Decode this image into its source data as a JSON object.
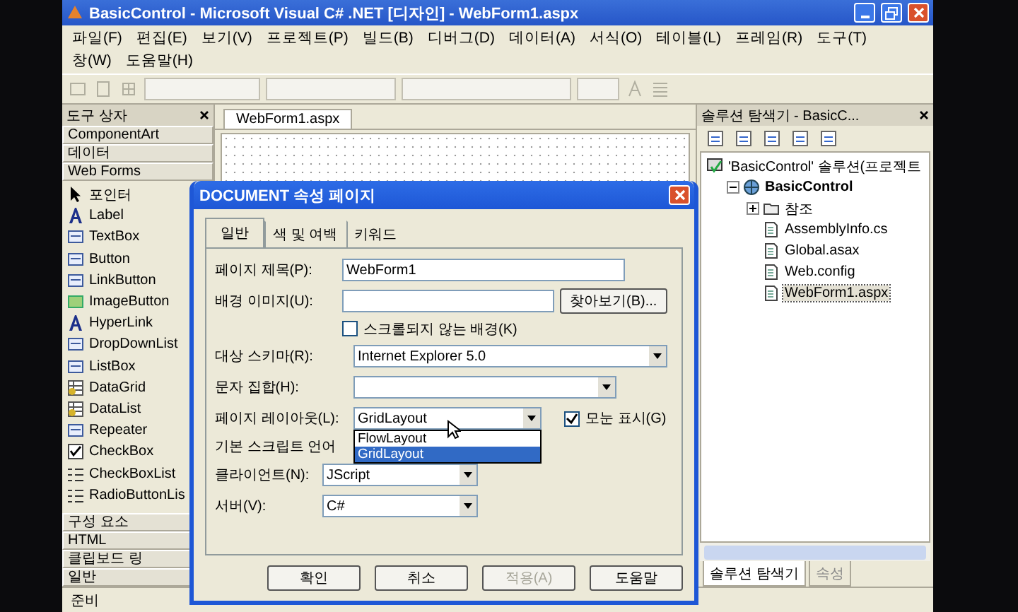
{
  "window": {
    "title": "BasicControl - Microsoft Visual C# .NET [디자인] - WebForm1.aspx"
  },
  "menu": [
    "파일(F)",
    "편집(E)",
    "보기(V)",
    "프로젝트(P)",
    "빌드(B)",
    "디버그(D)",
    "데이터(A)",
    "서식(O)",
    "테이블(L)",
    "프레임(R)",
    "도구(T)",
    "창(W)",
    "도움말(H)"
  ],
  "toolbox": {
    "title": "도구 상자",
    "top_groups": [
      "ComponentArt",
      "데이터",
      "Web Forms"
    ],
    "items": [
      {
        "label": "포인터",
        "kind": "pointer"
      },
      {
        "label": "Label",
        "kind": "letter"
      },
      {
        "label": "TextBox",
        "kind": "control"
      },
      {
        "label": "Button",
        "kind": "control"
      },
      {
        "label": "LinkButton",
        "kind": "control"
      },
      {
        "label": "ImageButton",
        "kind": "image"
      },
      {
        "label": "HyperLink",
        "kind": "letter"
      },
      {
        "label": "DropDownList",
        "kind": "control"
      },
      {
        "label": "ListBox",
        "kind": "control"
      },
      {
        "label": "DataGrid",
        "kind": "grid"
      },
      {
        "label": "DataList",
        "kind": "grid"
      },
      {
        "label": "Repeater",
        "kind": "control"
      },
      {
        "label": "CheckBox",
        "kind": "check"
      },
      {
        "label": "CheckBoxList",
        "kind": "list"
      },
      {
        "label": "RadioButtonLis",
        "kind": "list"
      }
    ],
    "bottom_groups": [
      "구성 요소",
      "HTML",
      "클립보드 링",
      "일반"
    ]
  },
  "document": {
    "tab": "WebForm1.aspx"
  },
  "solution_explorer": {
    "title": "솔루션 탐색기 - BasicC...",
    "tree": [
      {
        "label": "'BasicControl' 솔루션(프로젝트",
        "kind": "solution",
        "selected": false,
        "children": [
          {
            "label": "BasicControl",
            "kind": "project",
            "selected": false,
            "expanded": true,
            "children": [
              {
                "label": "참조",
                "kind": "folder",
                "selected": false,
                "expanded": false
              },
              {
                "label": "AssemblyInfo.cs",
                "kind": "file",
                "selected": false
              },
              {
                "label": "Global.asax",
                "kind": "file",
                "selected": false
              },
              {
                "label": "Web.config",
                "kind": "file",
                "selected": false
              },
              {
                "label": "WebForm1.aspx",
                "kind": "file",
                "selected": true
              }
            ]
          }
        ]
      }
    ]
  },
  "bottom_tabs": [
    {
      "label": "솔루션 탐색기",
      "selected": true
    },
    {
      "label": "속성",
      "selected": false
    }
  ],
  "status_bar": "준비",
  "dialog": {
    "title": "DOCUMENT 속성 페이지",
    "tabs": [
      {
        "label": "일반",
        "selected": true
      },
      {
        "label": "색 및 여백",
        "selected": false
      },
      {
        "label": "키워드",
        "selected": false
      }
    ],
    "page_title": {
      "label": "페이지 제목(P):",
      "value": "WebForm1"
    },
    "background_image": {
      "label": "배경 이미지(U):",
      "button": "찾아보기(B)..."
    },
    "no_scroll_background": {
      "label": "스크롤되지 않는 배경(K)",
      "checked": false
    },
    "target_schema": {
      "label": "대상 스키마(R):",
      "value": "Internet Explorer 5.0"
    },
    "charset": {
      "label": "문자 집합(H):"
    },
    "page_layout": {
      "label": "페이지 레이아웃(L):",
      "value": "GridLayout",
      "options": [
        {
          "label": "FlowLayout",
          "selected": false
        },
        {
          "label": "GridLayout",
          "selected": true
        }
      ]
    },
    "show_grid": {
      "label": "모눈 표시(G)",
      "checked": true
    },
    "script_language": "기본 스크립트 언어",
    "client": {
      "label": "클라이언트(N):",
      "value": "JScript"
    },
    "server": {
      "label": "서버(V):",
      "value": "C#"
    },
    "buttons": [
      {
        "label": "확인",
        "disabled": false
      },
      {
        "label": "취소",
        "disabled": false
      },
      {
        "label": "적용(A)",
        "disabled": true
      },
      {
        "label": "도움말",
        "disabled": false
      }
    ]
  }
}
